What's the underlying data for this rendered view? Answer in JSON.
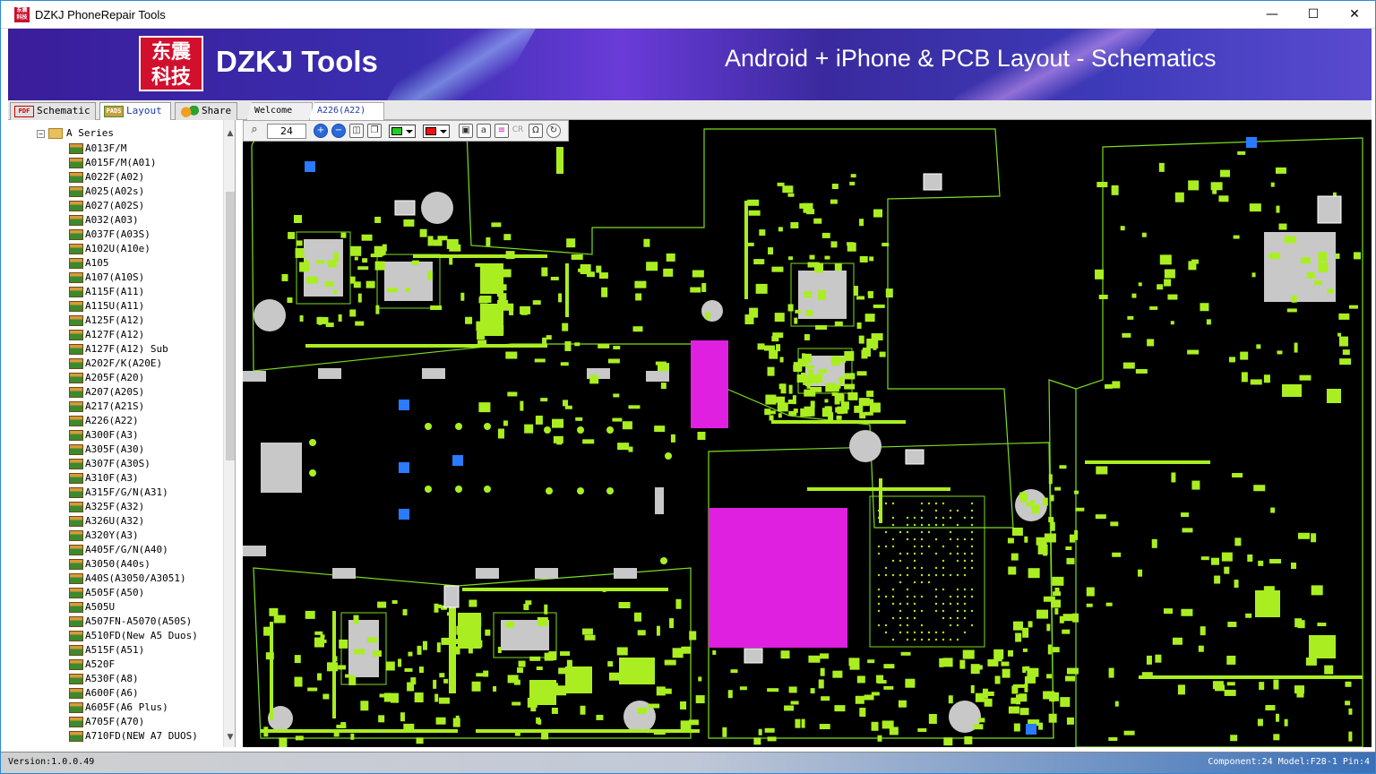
{
  "window": {
    "title": "DZKJ PhoneRepair Tools",
    "minimize": "—",
    "maximize": "☐",
    "close": "✕"
  },
  "banner": {
    "logo_text": "东震科技",
    "brand": "DZKJ Tools",
    "tagline": "Android + iPhone & PCB Layout - Schematics"
  },
  "tool_tabs": [
    {
      "icon": "pdf-icon",
      "label": "Schematic",
      "active": false
    },
    {
      "icon": "pads-icon",
      "label": "Layout",
      "active": true
    },
    {
      "icon": "share-icon",
      "label": "Share",
      "active": false
    }
  ],
  "doc_tabs": [
    {
      "label": "Welcome",
      "active": false
    },
    {
      "label": "A226(A22)",
      "active": true,
      "close": "×"
    }
  ],
  "tree": {
    "root": {
      "expander": "−",
      "label": "A Series"
    },
    "items": [
      "A013F/M",
      "A015F/M(A01)",
      "A022F(A02)",
      "A025(A02s)",
      "A027(A02S)",
      "A032(A03)",
      "A037F(A03S)",
      "A102U(A10e)",
      "A105",
      "A107(A10S)",
      "A115F(A11)",
      "A115U(A11)",
      "A125F(A12)",
      "A127F(A12)",
      "A127F(A12) Sub",
      "A202F/K(A20E)",
      "A205F(A20)",
      "A207(A20S)",
      "A217(A21S)",
      "A226(A22)",
      "A300F(A3)",
      "A305F(A30)",
      "A307F(A30S)",
      "A310F(A3)",
      "A315F/G/N(A31)",
      "A325F(A32)",
      "A326U(A32)",
      "A320Y(A3)",
      "A405F/G/N(A40)",
      "A3050(A40s)",
      "A40S(A3050/A3051)",
      "A505F(A50)",
      "A505U",
      "A507FN-A5070(A50S)",
      "A510FD(New A5 Duos)",
      "A515F(A51)",
      "A520F",
      "A530F(A8)",
      "A600F(A6)",
      "A605F(A6 Plus)",
      "A705F(A70)",
      "A710FD(NEW A7 DUOS)"
    ]
  },
  "scroll": {
    "up": "▲",
    "down": "▼"
  },
  "toolbar": {
    "zoom_value": "24",
    "zoom_in": "+",
    "zoom_out": "−",
    "fill_color": "#22cc22",
    "line_color": "#ee1111",
    "labels": [
      "a",
      "CR",
      "Ω"
    ]
  },
  "pcb": {
    "background": "#000000",
    "trace": "#7cdd22",
    "pad": "#aaee22",
    "gray": "#c8c8c8",
    "magenta": "#e020e0",
    "blue": "#2a7bff"
  },
  "status": {
    "version": "Version:1.0.0.49",
    "info": "Component:24 Model:F28-1 Pin:4"
  }
}
